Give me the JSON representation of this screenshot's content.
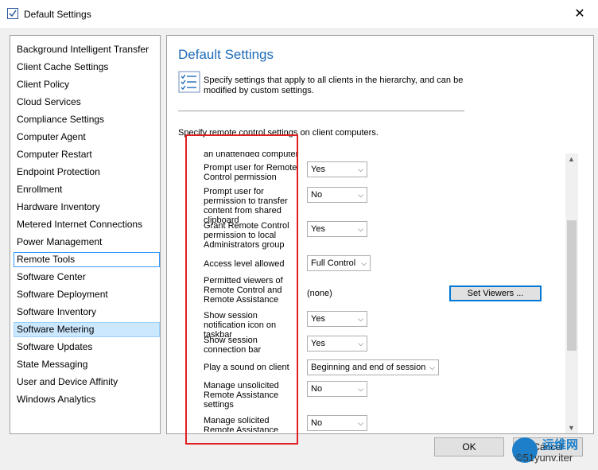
{
  "window": {
    "title": "Default Settings",
    "close_glyph": "✕"
  },
  "nav": {
    "items": [
      "Background Intelligent Transfer",
      "Client Cache Settings",
      "Client Policy",
      "Cloud Services",
      "Compliance Settings",
      "Computer Agent",
      "Computer Restart",
      "Endpoint Protection",
      "Enrollment",
      "Hardware Inventory",
      "Metered Internet Connections",
      "Power Management",
      "Remote Tools",
      "Software Center",
      "Software Deployment",
      "Software Inventory",
      "Software Metering",
      "Software Updates",
      "State Messaging",
      "User and Device Affinity",
      "Windows Analytics"
    ],
    "outlined_item": "Remote Tools",
    "selected_item": "Software Metering"
  },
  "content": {
    "title": "Default Settings",
    "description": "Specify settings that apply to all clients in the hierarchy, and can be modified by custom settings.",
    "subtitle": "Specify remote control settings on client computers.",
    "settings": [
      {
        "label": "Prompt user for Remote Control permission",
        "value": "Yes",
        "control": "dropdown"
      },
      {
        "label": "Prompt user for permission to transfer content from shared clipboard",
        "value": "No",
        "control": "dropdown"
      },
      {
        "label": "Grant Remote Control permission to local Administrators group",
        "value": "Yes",
        "control": "dropdown"
      },
      {
        "label": "Access level allowed",
        "value": "Full Control",
        "control": "dropdown"
      },
      {
        "label": "Permitted viewers of Remote Control and Remote Assistance",
        "value": "(none)",
        "control": "text",
        "button": "Set Viewers ..."
      },
      {
        "label": "Show session notification icon on taskbar",
        "value": "Yes",
        "control": "dropdown"
      },
      {
        "label": "Show session connection bar",
        "value": "Yes",
        "control": "dropdown"
      },
      {
        "label": "Play a sound on client",
        "value": "Beginning and end of session",
        "control": "dropdown"
      },
      {
        "label": "Manage unsolicited Remote Assistance settings",
        "value": "No",
        "control": "dropdown"
      },
      {
        "label": "Manage solicited Remote Assistance settings",
        "value": "No",
        "control": "dropdown"
      }
    ],
    "partial_top_label": "an unattended computer"
  },
  "buttons": {
    "ok": "OK",
    "cancel": "Cancel"
  },
  "watermark": {
    "line1": "运维网",
    "line2": "©51yunv.iter"
  },
  "colors": {
    "title_blue": "#1e6bb8",
    "highlight_box": "#e02020",
    "selection": "#cce8ff"
  }
}
